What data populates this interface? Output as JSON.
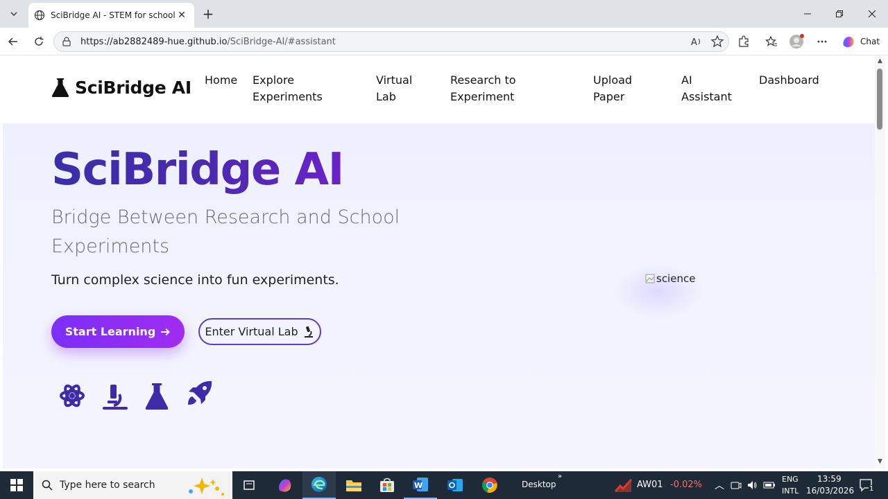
{
  "browser": {
    "tab_title": "SciBridge AI - STEM for schools",
    "url_host": "https://ab2882489-hue.github.io",
    "url_path": "/SciBridge-AI/#assistant",
    "chat_label": "Chat"
  },
  "site": {
    "brand": "SciBridge AI",
    "nav": [
      "Home",
      "Explore Experiments",
      "Virtual Lab",
      "Research to Experiment",
      "Upload Paper",
      "AI Assistant",
      "Dashboard"
    ]
  },
  "hero": {
    "title": "SciBridge AI",
    "subtitle": "Bridge Between Research and School Experiments",
    "tagline": "Turn complex science into fun experiments.",
    "primary_button": "Start Learning",
    "secondary_button": "Enter Virtual Lab",
    "image_alt": "science",
    "icons": [
      "atom-icon",
      "microscope-icon",
      "flask-icon",
      "rocket-icon"
    ],
    "accent": "#5b2bbf"
  },
  "taskbar": {
    "search_placeholder": "Type here to search",
    "desktop_label": "Desktop",
    "stock_symbol": "AW01",
    "stock_change": "-0.02%",
    "lang_1": "ENG",
    "lang_2": "INTL",
    "time": "13:59",
    "date": "16/03/2026",
    "notification_count": "1"
  }
}
